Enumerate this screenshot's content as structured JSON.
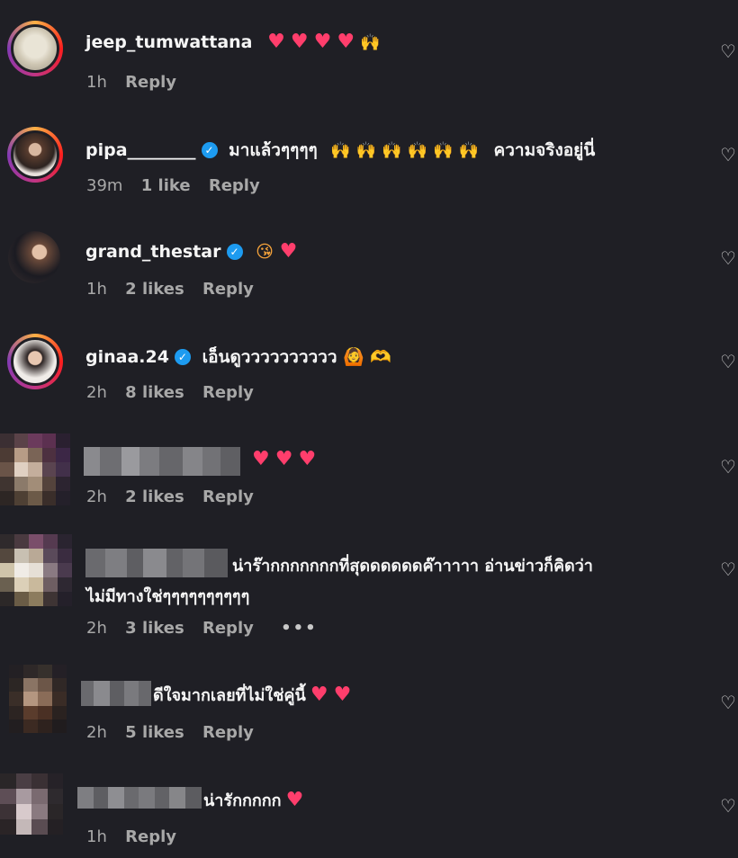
{
  "comments": [
    {
      "username": "jeep_tumwattana",
      "verified": false,
      "text": "",
      "emojis": "❤️ ❤️ ❤️ ❤️ 🙌",
      "time": "1h",
      "likes": "",
      "reply": "Reply"
    },
    {
      "username": "pipa________",
      "verified": true,
      "text": "มาแล้วๆๆๆๆ",
      "emojis": "🙌 🙌 🙌 🙌 🙌 🙌",
      "text2": "ความจริงอยู่นี่",
      "time": "39m",
      "likes": "1 like",
      "reply": "Reply"
    },
    {
      "username": "grand_thestar",
      "verified": true,
      "text": "",
      "emojis": "😘 ❤️",
      "time": "1h",
      "likes": "2 likes",
      "reply": "Reply"
    },
    {
      "username": "ginaa.24",
      "verified": true,
      "text": "เอ็นดูวววววววววว",
      "emojis": "🙆 🫶",
      "time": "2h",
      "likes": "8 likes",
      "reply": "Reply"
    },
    {
      "username": "",
      "verified": false,
      "text": "",
      "emojis": "❤️ ❤️ ❤️",
      "time": "2h",
      "likes": "2 likes",
      "reply": "Reply"
    },
    {
      "username": "",
      "verified": false,
      "text": "น่าร๊ากกกกกกกที่สุดดดดดดค๊าาาาา อ่านข่าวก็คิดว่า",
      "text_line2": "ไม่มีทางใช่ๆๆๆๆๆๆๆๆๆๆ",
      "emojis": "",
      "time": "2h",
      "likes": "3 likes",
      "reply": "Reply",
      "more": "•••"
    },
    {
      "username": "",
      "verified": false,
      "text": "ดีใจมากเลยที่ไม่ใช่คู่นี้",
      "emojis": "❤️ ❤️",
      "time": "2h",
      "likes": "5 likes",
      "reply": "Reply"
    },
    {
      "username": "",
      "verified": false,
      "text": "น่ารักกกกก",
      "emojis": "❤️",
      "time": "1h",
      "likes": "",
      "reply": "Reply"
    }
  ],
  "icons": {
    "like": "heart-outline-icon",
    "verified": "verified-badge-icon",
    "more": "more-options-icon"
  },
  "colors": {
    "background": "#1f1f25",
    "text": "#f5f5f5",
    "muted": "#a8a8a8",
    "verified": "#1d9bf0",
    "heart": "#ff3e6c"
  }
}
